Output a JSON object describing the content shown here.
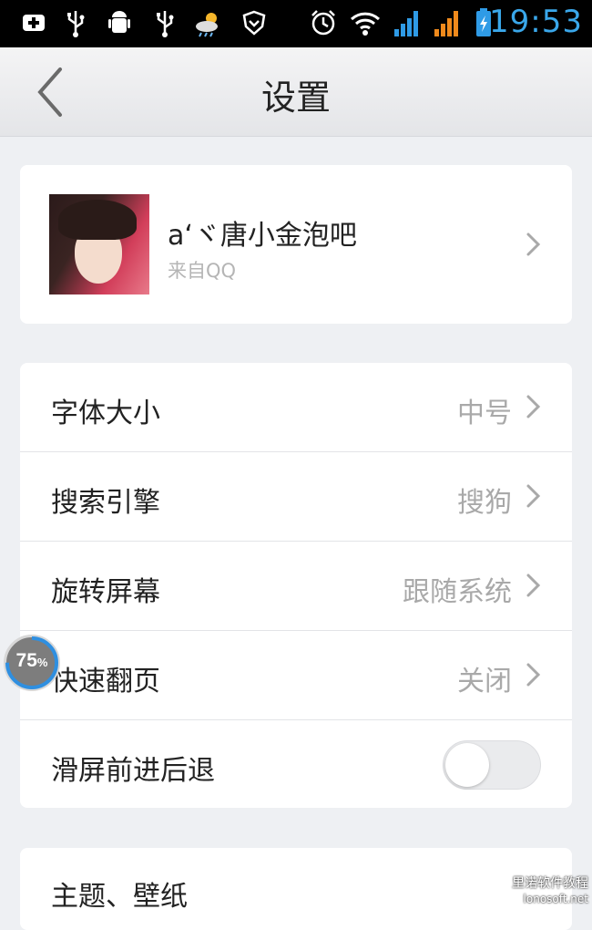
{
  "status_bar": {
    "time": "19:53",
    "icons": [
      "notification-plus-icon",
      "usb-icon",
      "android-debug-icon",
      "usb-icon",
      "weather-icon",
      "shield-icon",
      "alarm-icon",
      "wifi-icon",
      "signal-icon",
      "signal-icon",
      "battery-icon"
    ],
    "colors": {
      "time": "#3aa7ea",
      "signal_blue": "#2f9be6",
      "signal_orange": "#f08a1c"
    }
  },
  "header": {
    "title": "设置",
    "back_icon": "chevron-left-icon"
  },
  "profile": {
    "name": "aʻヾ唐小金泡吧",
    "source": "来自QQ"
  },
  "settings": [
    {
      "label": "字体大小",
      "value": "中号"
    },
    {
      "label": "搜索引擎",
      "value": "搜狗"
    },
    {
      "label": "旋转屏幕",
      "value": "跟随系统"
    },
    {
      "label": "快速翻页",
      "value": "关闭"
    },
    {
      "label": "滑屏前进后退",
      "toggle": false
    }
  ],
  "theme": {
    "label": "主题、壁纸"
  },
  "floating_progress": {
    "value": "75",
    "unit": "%",
    "fraction": 0.75
  },
  "watermark": {
    "line1": "里诺软件教程",
    "line2": "lonosoft.net"
  }
}
